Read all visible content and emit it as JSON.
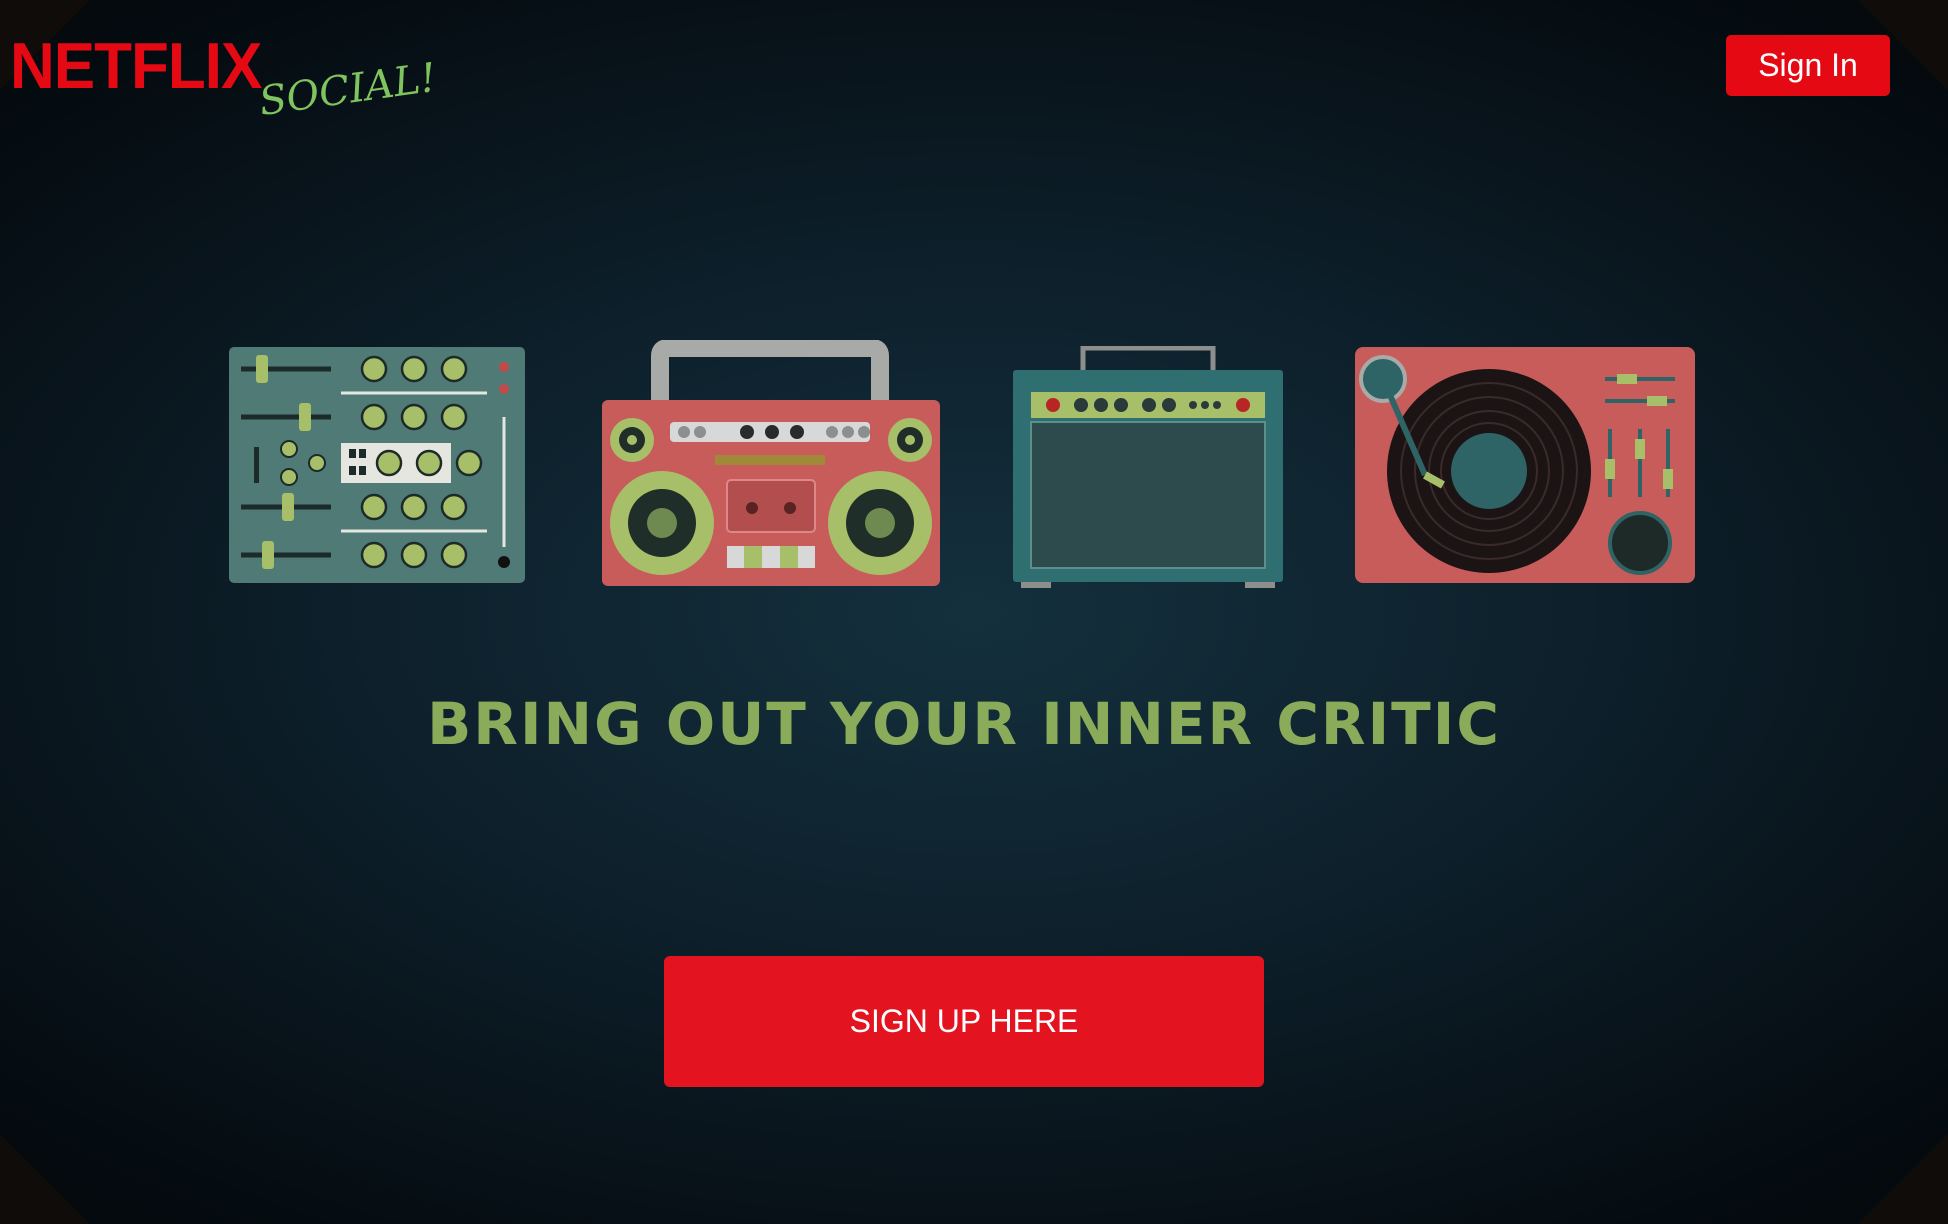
{
  "header": {
    "logo_brand": "NETFLIX",
    "logo_sub": "SOCIAL!",
    "signin_label": "Sign In"
  },
  "hero": {
    "illustrations": [
      "mixer-icon",
      "boombox-icon",
      "amplifier-icon",
      "turntable-icon"
    ],
    "tagline": "BRING OUT YOUR INNER CRITIC",
    "signup_label": "SIGN UP HERE"
  },
  "colors": {
    "brand_red": "#e50914",
    "tagline_green": "#8aac5a",
    "logo_green": "#7fc45e",
    "background": "#0d202b"
  }
}
